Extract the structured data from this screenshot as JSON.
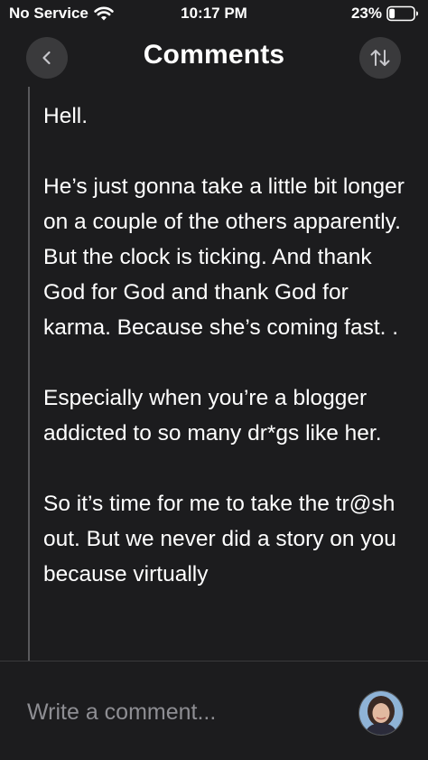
{
  "status_bar": {
    "carrier": "No Service",
    "time": "10:17 PM",
    "battery_percent": "23%",
    "battery_level": 0.23,
    "wifi_icon": "wifi-icon",
    "battery_icon": "battery-icon"
  },
  "nav": {
    "title": "Comments",
    "back_icon": "chevron-left-icon",
    "sort_icon": "sort-arrows-icon"
  },
  "comment": {
    "paragraphs": [
      "Hell.",
      "He’s just gonna take a little bit longer on a couple of the others apparently. But the clock is ticking. And thank God for God and thank God for karma. Because she’s coming fast. .",
      "Especially when you’re a blogger addicted to so many dr*gs like her.",
      "So it’s time for me to take the tr@sh  out. But we never did a story on you because virtually"
    ]
  },
  "composer": {
    "placeholder": "Write a comment...",
    "value": ""
  },
  "colors": {
    "background": "#1c1c1e",
    "button_bg": "#3a3a3c",
    "text": "#ffffff",
    "placeholder": "#8e8e93",
    "thread_line": "#59595c"
  }
}
